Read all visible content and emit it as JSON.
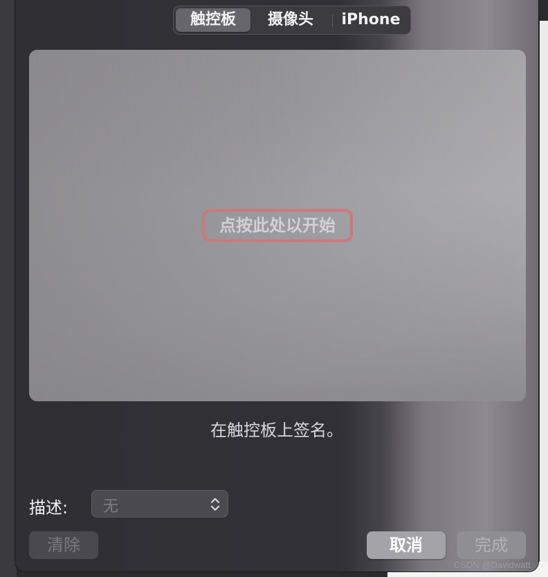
{
  "tabs": [
    {
      "label": "触控板",
      "active": true
    },
    {
      "label": "摄像头",
      "active": false
    },
    {
      "label": "iPhone",
      "active": false
    }
  ],
  "pad": {
    "hint": "点按此处以开始"
  },
  "caption": "在触控板上签名。",
  "description": {
    "label": "描述:",
    "value": "无"
  },
  "buttons": {
    "clear": "清除",
    "cancel": "取消",
    "done": "完成"
  },
  "watermark": "CSDN @Davidwatt",
  "colors": {
    "highlight_border": "#c97a7c",
    "sheet_background": "#302f34",
    "pad_background": "#979699"
  }
}
